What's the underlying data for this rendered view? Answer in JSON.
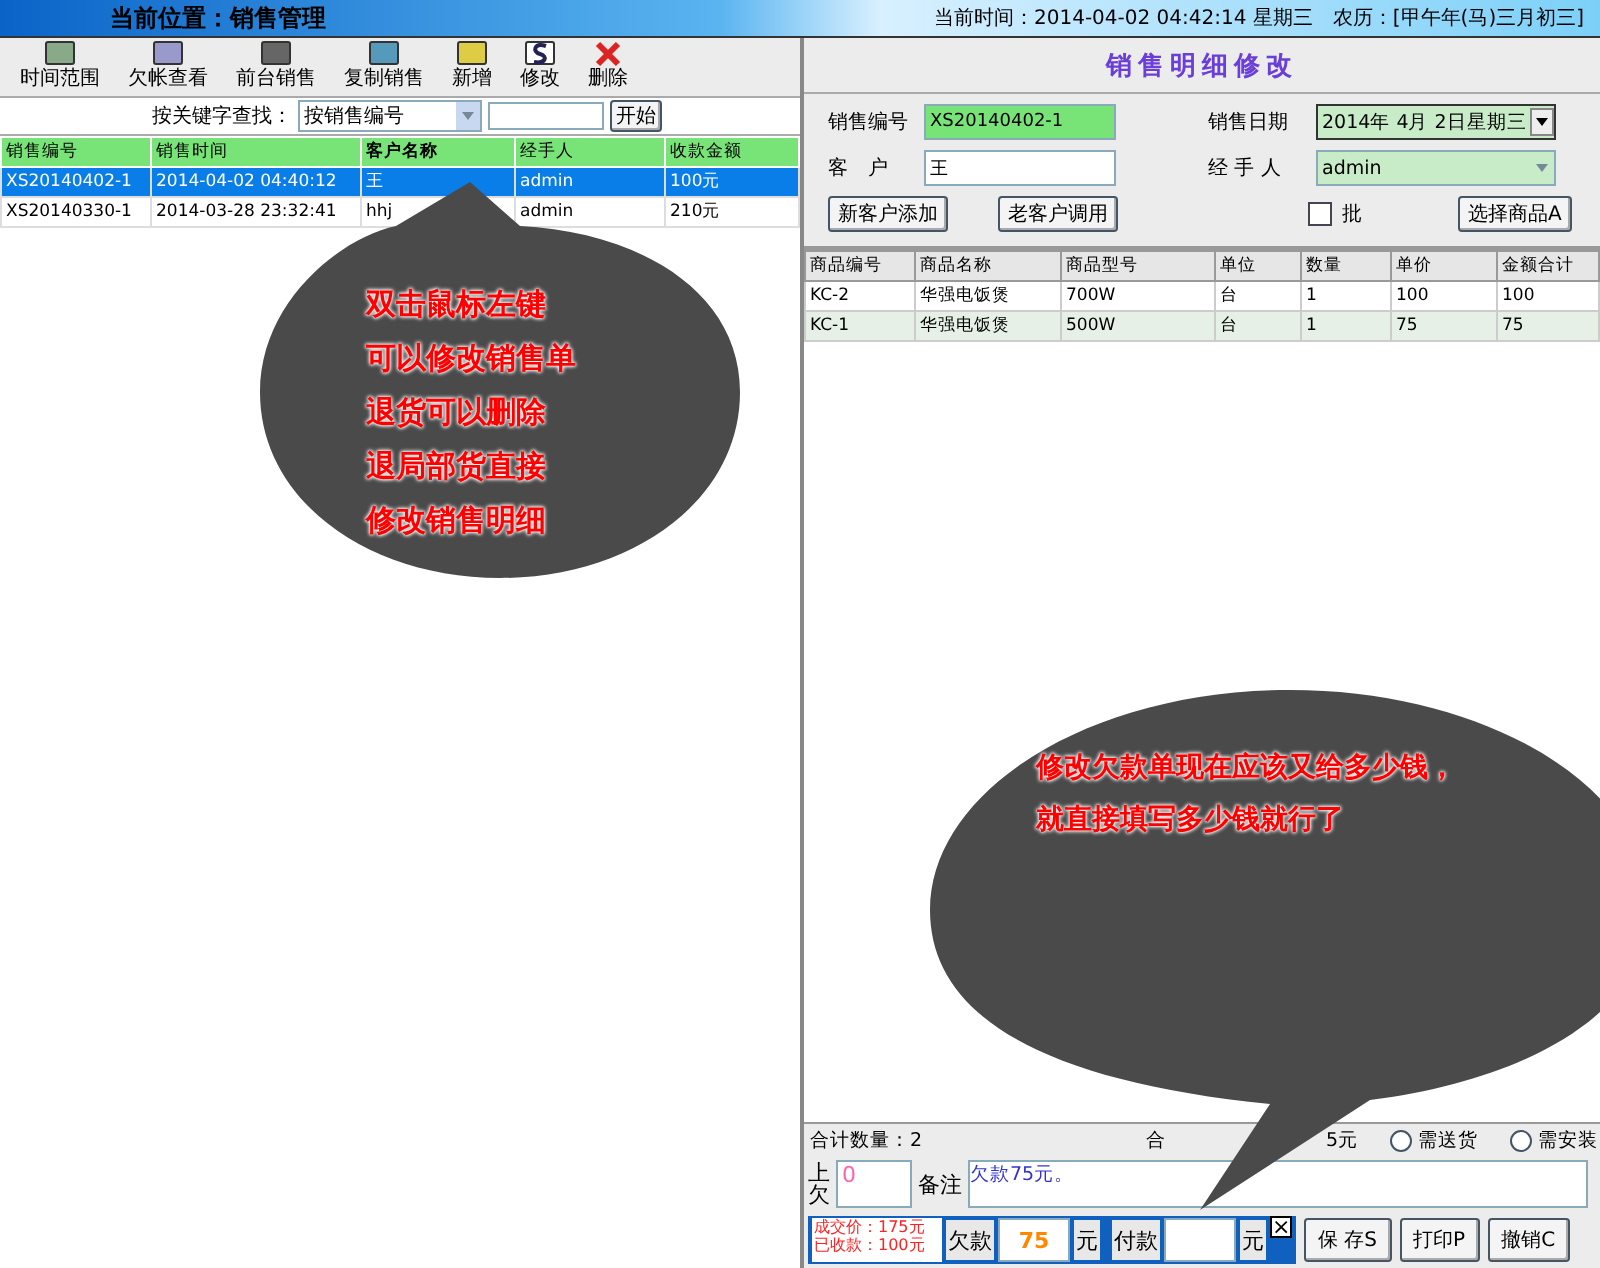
{
  "header": {
    "location": "当前位置：销售管理",
    "clock": "当前时间：2014-04-02 04:42:14 星期三　农历：[甲午年(马)三月初三]"
  },
  "toolbar": [
    {
      "label": "时间范围"
    },
    {
      "label": "欠帐查看"
    },
    {
      "label": "前台销售"
    },
    {
      "label": "复制销售"
    },
    {
      "label": "新增"
    },
    {
      "label": "修改"
    },
    {
      "label": "删除"
    }
  ],
  "search": {
    "label": "按关键字查找：",
    "mode": "按销售编号",
    "button": "开始"
  },
  "sales_table": {
    "columns": [
      "销售编号",
      "销售时间",
      "客户名称",
      "经手人",
      "收款金额"
    ],
    "rows": [
      {
        "cells": [
          "XS20140402-1",
          "2014-04-02 04:40:12",
          "王",
          "admin",
          "100元"
        ],
        "selected": true
      },
      {
        "cells": [
          "XS20140330-1",
          "2014-03-28 23:32:41",
          "hhj",
          "admin",
          "210元"
        ],
        "selected": false
      }
    ]
  },
  "detail": {
    "title": "销售明细修改",
    "sale_no": {
      "label": "销售编号",
      "value": "XS20140402-1"
    },
    "sale_date": {
      "label": "销售日期",
      "value": "2014年 4月 2日星期三"
    },
    "customer": {
      "label": "客　户",
      "value": "王"
    },
    "handler": {
      "label": "经 手 人",
      "value": "admin"
    },
    "buttons": [
      "新客户添加",
      "老客户调用"
    ],
    "wholesale": {
      "label": "批",
      "checked": false
    },
    "pick_button": "选择商品A",
    "items": {
      "columns": [
        "商品编号",
        "商品名称",
        "商品型号",
        "单位",
        "数量",
        "单价",
        "金额合计"
      ],
      "rows": [
        [
          "KC-2",
          "华强电饭煲",
          "700W",
          "台",
          "1",
          "100",
          "100"
        ],
        [
          "KC-1",
          "华强电饭煲",
          "500W",
          "台",
          "1",
          "75",
          "75"
        ]
      ]
    },
    "total_qty": "合计数量：2",
    "total_left": "合",
    "total_right": "5元",
    "options": [
      {
        "label": "需送货",
        "selected": false
      },
      {
        "label": "需安装",
        "selected": false
      }
    ],
    "prev_debt": {
      "label": "上欠",
      "value": "0"
    },
    "remark": {
      "label": "备注",
      "value": "欠款75元。"
    },
    "summary": [
      "成交价：175元",
      "已收款：100元"
    ],
    "debt": {
      "label": "欠款",
      "value": "75",
      "unit": "元"
    },
    "pay": {
      "label": "付款",
      "unit": "元"
    },
    "close": "×",
    "actions": [
      "保 存S",
      "打印P",
      "撤销C"
    ]
  },
  "callouts": [
    {
      "lines": [
        "双击鼠标左键",
        "可以修改销售单",
        "退货可以删除",
        "退局部货直接",
        "修改销售明细"
      ]
    },
    {
      "lines": [
        "修改欠款单现在应该又给多少钱，",
        "就直接填写多少钱就行了"
      ]
    }
  ]
}
